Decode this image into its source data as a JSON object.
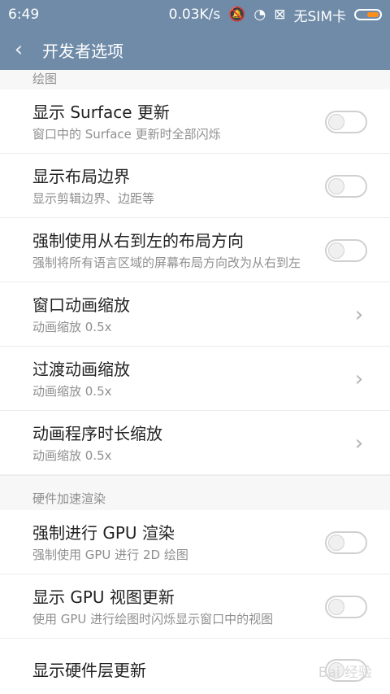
{
  "status": {
    "time": "6:49",
    "speed": "0.03K/s",
    "sim": "无SIM卡"
  },
  "appbar": {
    "title": "开发者选项",
    "back_icon": "chevron-left-icon"
  },
  "section_drawing": "绘图",
  "drawing_items": [
    {
      "title": "显示 Surface 更新",
      "subtitle": "窗口中的 Surface 更新时全部闪烁",
      "control": "toggle",
      "on": false
    },
    {
      "title": "显示布局边界",
      "subtitle": "显示剪辑边界、边距等",
      "control": "toggle",
      "on": false
    },
    {
      "title": "强制使用从右到左的布局方向",
      "subtitle": "强制将所有语言区域的屏幕布局方向改为从右到左",
      "control": "toggle",
      "on": false
    },
    {
      "title": "窗口动画缩放",
      "subtitle": "动画缩放 0.5x",
      "control": "chevron"
    },
    {
      "title": "过渡动画缩放",
      "subtitle": "动画缩放 0.5x",
      "control": "chevron"
    },
    {
      "title": "动画程序时长缩放",
      "subtitle": "动画缩放 0.5x",
      "control": "chevron"
    }
  ],
  "section_hw": "硬件加速渲染",
  "hw_items": [
    {
      "title": "强制进行 GPU 渲染",
      "subtitle": "强制使用 GPU 进行 2D 绘图",
      "control": "toggle",
      "on": false
    },
    {
      "title": "显示 GPU 视图更新",
      "subtitle": "使用 GPU 进行绘图时闪烁显示窗口中的视图",
      "control": "toggle",
      "on": false
    },
    {
      "title": "显示硬件层更新",
      "subtitle": "",
      "control": "toggle",
      "on": false
    }
  ],
  "watermark": "Bai 经验",
  "colors": {
    "header": "#6f8ba8",
    "battery_fill": "#ff8d1a",
    "bg": "#f7f7f7"
  }
}
